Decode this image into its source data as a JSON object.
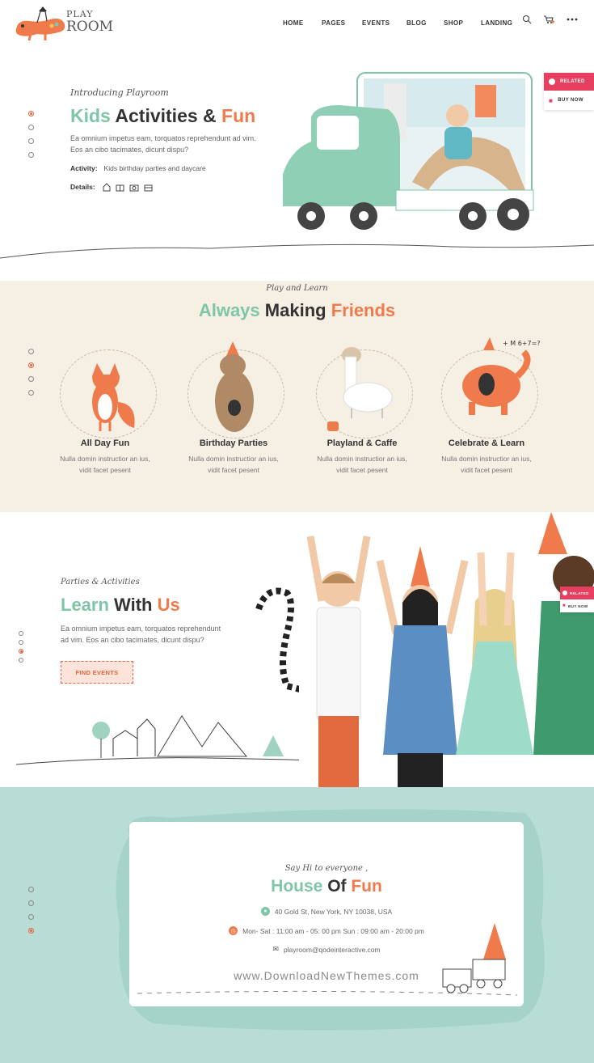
{
  "header": {
    "logo": {
      "line1": "PLAY",
      "line2": "ROOM"
    },
    "nav": [
      "HOME",
      "PAGES",
      "EVENTS",
      "BLOG",
      "SHOP",
      "LANDING"
    ],
    "icons": [
      "search-icon",
      "cart-icon",
      "more-icon"
    ]
  },
  "side_widget": {
    "related": "RELATED",
    "buy_now": "BUY NOW"
  },
  "hero": {
    "intro": "Introducing Playroom",
    "title_part1": "Kids",
    "title_part2": "Activities &",
    "title_part3": "Fun",
    "description": "Ea omnium impetus eam, torquatos reprehendunt ad vim. Eos an cibo tacimates, dicunt dispu?",
    "activity_label": "Activity:",
    "activity_value": "Kids birthday parties and daycare",
    "details_label": "Details:"
  },
  "friends_section": {
    "subtitle": "Play and Learn",
    "title_part1": "Always",
    "title_part2": "Making",
    "title_part3": "Friends",
    "features": [
      {
        "title": "All Day Fun",
        "text1": "Nulla domin instructior an ius,",
        "text2": "vidit facet pesent"
      },
      {
        "title": "Birthday Parties",
        "text1": "Nulla domin instructior an ius,",
        "text2": "vidit facet pesent"
      },
      {
        "title": "Playland & Caffe",
        "text1": "Nulla domin instructior an ius,",
        "text2": "vidit facet pesent"
      },
      {
        "title": "Celebrate & Learn",
        "text1": "Nulla domin instructior an ius,",
        "text2": "vidit facet pesent"
      }
    ]
  },
  "learn_section": {
    "subtitle": "Parties & Activities",
    "title_part1": "Learn",
    "title_part2": "With",
    "title_part3": "Us",
    "description": "Ea omnium impetus eam, torquatos reprehendunt ad vim. Eos an cibo tacimates, dicunt dispu?",
    "button": "FIND EVENTS"
  },
  "contact_section": {
    "subtitle": "Say Hi to everyone ,",
    "title_part1": "House",
    "title_part2": "Of",
    "title_part3": "Fun",
    "address": "40 Gold St, New York, NY 10038, USA",
    "hours": "Mon- Sat : 11:00 am - 05: 00 pm  Sun : 09:00 am - 20:00 pm",
    "email": "playroom@qodeinteractive.com",
    "watermark": "www.DownloadNewThemes.com"
  },
  "colors": {
    "green": "#7fc5a8",
    "orange": "#ef7a4b",
    "red": "#e73f5f",
    "beige": "#f6efe4",
    "mint": "#b7ddd4"
  }
}
